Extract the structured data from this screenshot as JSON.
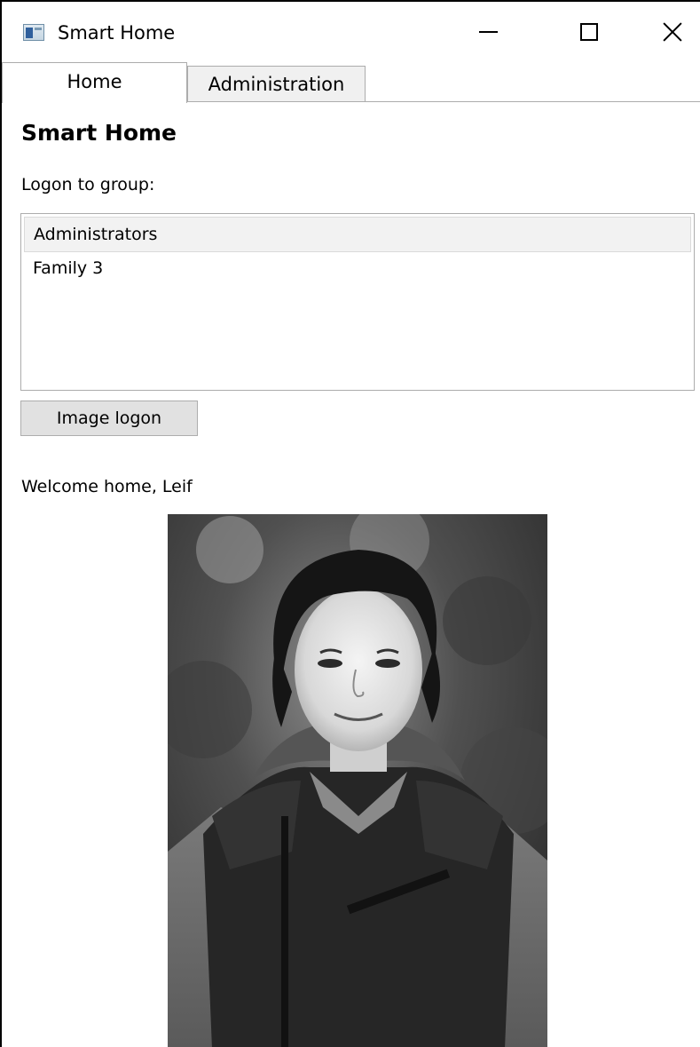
{
  "window": {
    "title": "Smart Home",
    "icon": "app-window-icon",
    "controls": {
      "minimize_icon": "minimize-icon",
      "maximize_icon": "maximize-icon",
      "close_icon": "close-icon"
    }
  },
  "tabs": [
    {
      "label": "Home",
      "selected": true
    },
    {
      "label": "Administration",
      "selected": false
    }
  ],
  "main": {
    "heading": "Smart Home",
    "group_label": "Logon to group:",
    "groups": [
      {
        "label": "Administrators",
        "selected": true
      },
      {
        "label": "Family 3",
        "selected": false
      }
    ],
    "logon_button": "Image logon",
    "welcome": "Welcome home, Leif"
  },
  "colors": {
    "tab_border": "#acacac",
    "inactive_tab_bg": "#f0f0f0",
    "button_bg": "#e1e1e1",
    "selected_item_bg": "#f2f2f2"
  }
}
